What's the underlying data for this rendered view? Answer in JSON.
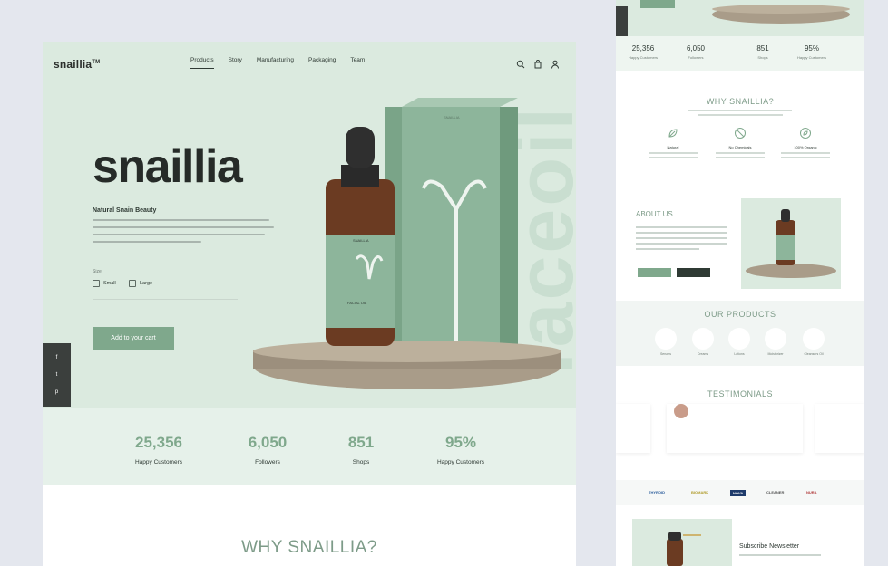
{
  "brand": {
    "logo": "snaillia",
    "logo_mark": "TM",
    "hero_word": "snaillia"
  },
  "nav": {
    "items": [
      "Products",
      "Story",
      "Manufacturing",
      "Packaging",
      "Team"
    ],
    "active": "Products"
  },
  "hero": {
    "subtitle": "Natural Snain Beauty",
    "size_label": "Size:",
    "options": [
      "Small",
      "Large"
    ],
    "cta": "Add to your cart",
    "side_word": "faceoil",
    "bottle_label": "SNAILLIA",
    "box_label": "SNAILLIA",
    "product_text": "FACIAL OIL"
  },
  "social": {
    "items": [
      "f",
      "t",
      "p"
    ]
  },
  "stats": [
    {
      "value": "25,356",
      "label": "Happy Customers"
    },
    {
      "value": "6,050",
      "label": "Followers"
    },
    {
      "value": "851",
      "label": "Shops"
    },
    {
      "value": "95%",
      "label": "Happy Customers"
    }
  ],
  "why": {
    "heading": "WHY SNAILLIA?"
  },
  "side": {
    "stats": [
      {
        "value": "25,356",
        "label": "Happy Customers"
      },
      {
        "value": "6,050",
        "label": "Followers"
      },
      {
        "value": "851",
        "label": "Shops"
      },
      {
        "value": "95%",
        "label": "Happy Customers"
      }
    ],
    "why_heading": "WHY SNAILLIA?",
    "features": [
      "Natural",
      "No Chemicals",
      "100% Organic"
    ],
    "about_heading": "ABOUT US",
    "products_heading": "OUR PRODUCTS",
    "products": [
      "Serums",
      "Creams",
      "Lotions",
      "Moisturizer",
      "Cleansers Oil"
    ],
    "testimonials_heading": "TESTIMONIALS",
    "logos": [
      "THYROID",
      "BIOMARK",
      "NOVA",
      "CLEANER",
      "NURA"
    ],
    "newsletter": "Subscribe Newsletter"
  },
  "colors": {
    "accent": "#7fa88c",
    "hero_bg": "#dbeadf",
    "dark": "#3b3f3d"
  }
}
